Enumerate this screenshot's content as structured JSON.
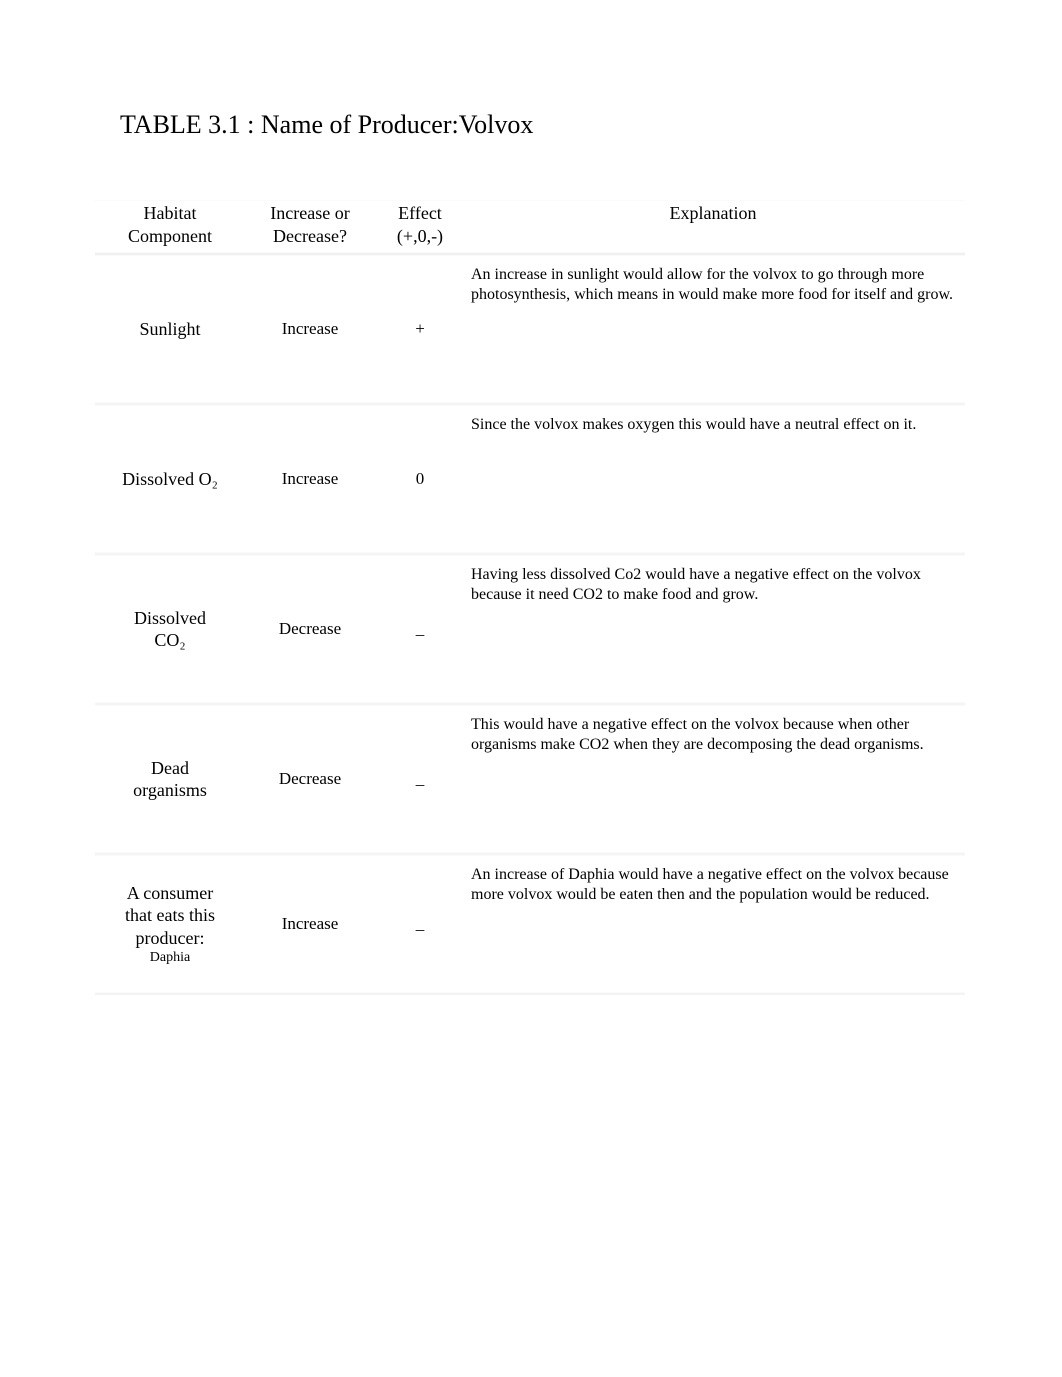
{
  "title": "TABLE 3.1 : Name of Producer:Volvox",
  "headers": {
    "habitat_l1": "Habitat",
    "habitat_l2": "Component",
    "change_l1": "Increase or",
    "change_l2": "Decrease?",
    "effect_l1": "Effect",
    "effect_l2": "(+,0,-)",
    "explanation": "Explanation"
  },
  "rows": [
    {
      "habitat": "Sunlight",
      "change": "Increase",
      "effect": "+",
      "explanation": "An increase in sunlight would allow for the volvox to go through more photosynthesis, which means in would make more food for itself and grow."
    },
    {
      "habitat": "Dissolved O₂",
      "change": "Increase",
      "effect": "0",
      "explanation": "Since the volvox makes oxygen this would have a neutral effect on it."
    },
    {
      "habitat_l1": "Dissolved",
      "habitat_l2": "CO₂",
      "change": "Decrease",
      "effect": "_",
      "explanation": "Having less dissolved Co2 would have a negative effect on the volvox because it need CO2 to make food and grow."
    },
    {
      "habitat_l1": "Dead",
      "habitat_l2": "organisms",
      "change": "Decrease",
      "effect": "_",
      "explanation": "This would have a negative effect on the volvox because when other organisms make CO2 when they are decomposing the dead organisms."
    },
    {
      "habitat_l1": "A consumer",
      "habitat_l2": "that eats this",
      "habitat_l3": "producer:",
      "habitat_l4": "Daphia",
      "change": "Increase",
      "effect": "_",
      "explanation": "An increase of Daphia would have a negative effect on the volvox because more volvox would be eaten then and the population would be reduced."
    }
  ]
}
